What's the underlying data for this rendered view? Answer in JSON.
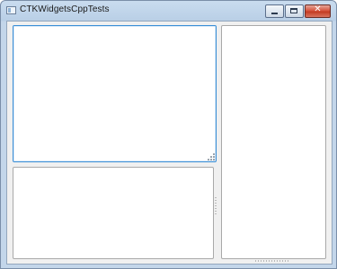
{
  "window": {
    "title": "CTKWidgetsCppTests",
    "app_icon": "window-app-icon",
    "buttons": {
      "minimize": {
        "icon": "minimize-icon"
      },
      "maximize": {
        "icon": "maximize-icon"
      },
      "close": {
        "icon": "close-icon",
        "glyph": "✕"
      }
    }
  },
  "colors": {
    "titlebar": "#b9cfe6",
    "client_background": "#f0f0f0",
    "focus_border": "#3c8fd6",
    "panel_border": "#a9a9a9",
    "close_button": "#c33b22"
  }
}
